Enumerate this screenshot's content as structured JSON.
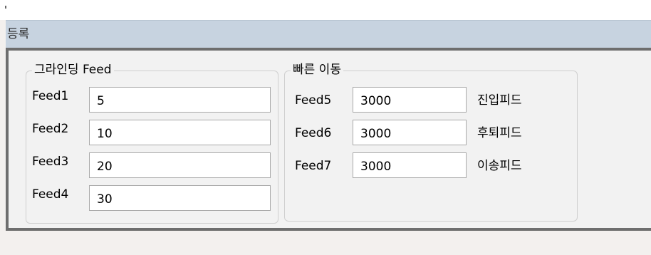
{
  "section": {
    "title": "등록"
  },
  "grinding": {
    "title": "그라인딩 Feed",
    "rows": [
      {
        "label": "Feed1",
        "value": "5"
      },
      {
        "label": "Feed2",
        "value": "10"
      },
      {
        "label": "Feed3",
        "value": "20"
      },
      {
        "label": "Feed4",
        "value": "30"
      }
    ]
  },
  "rapid": {
    "title": "빠른 이동",
    "rows": [
      {
        "label": "Feed5",
        "value": "3000",
        "desc": "진입피드"
      },
      {
        "label": "Feed6",
        "value": "3000",
        "desc": "후퇴피드"
      },
      {
        "label": "Feed7",
        "value": "3000",
        "desc": "이송피드"
      }
    ]
  }
}
